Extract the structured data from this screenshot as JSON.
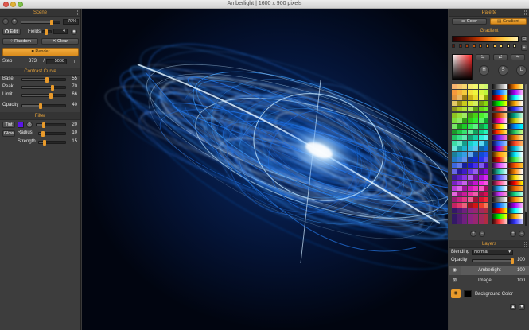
{
  "window": {
    "title": "Amberlight | 1600 x 900 pixels"
  },
  "scene": {
    "title": "Scene",
    "zoom_value": "70%",
    "edit_label": "Edit",
    "fields_label": "Fields",
    "fields_value": "4",
    "random_label": "Random",
    "clear_label": "Clear",
    "render_label": "Render",
    "step_label": "Step",
    "step_current": "373",
    "step_sep": "/",
    "step_total": "5000",
    "zoom_level": 0.78
  },
  "contrast": {
    "title": "Contrast Curve",
    "items": [
      {
        "label": "Base",
        "value": "55",
        "level": 0.55
      },
      {
        "label": "Peak",
        "value": "70",
        "level": 0.7
      },
      {
        "label": "Limit",
        "value": "66",
        "level": 0.66
      }
    ],
    "opacity_label": "Opacity",
    "opacity_value": "40",
    "opacity_level": 0.4
  },
  "filter": {
    "title": "Filter",
    "tint_label": "Tint",
    "tint_color": "#5a14e8",
    "tint_value": "20",
    "tint_level": 0.2,
    "glow_label": "Glow",
    "radius_label": "Radius",
    "radius_value": "10",
    "radius_level": 0.1,
    "strength_label": "Strength",
    "strength_value": "15",
    "strength_level": 0.15
  },
  "palette": {
    "title": "Palette",
    "color_tab": "Color",
    "gradient_tab": "Gradient",
    "gradient_title": "Gradient",
    "h_label": "H",
    "s_label": "S",
    "l_label": "L"
  },
  "layers": {
    "title": "Layers",
    "blending_label": "Blending",
    "blending_value": "Normal",
    "opacity_label": "Opacity",
    "opacity_value": "100",
    "opacity_level": 1.0,
    "items": [
      {
        "name": "Amberlight",
        "value": "100",
        "icon": "eye-icon"
      },
      {
        "name": "Image",
        "value": "100",
        "icon": "transparency-icon"
      },
      {
        "name": "Background Color",
        "value": "",
        "icon": "eye-icon"
      }
    ]
  },
  "colors": {
    "accent": "#e89a2b",
    "panel": "#3d3d3d",
    "canvas_bg": "#020714",
    "glow": "#3aa0ff"
  }
}
